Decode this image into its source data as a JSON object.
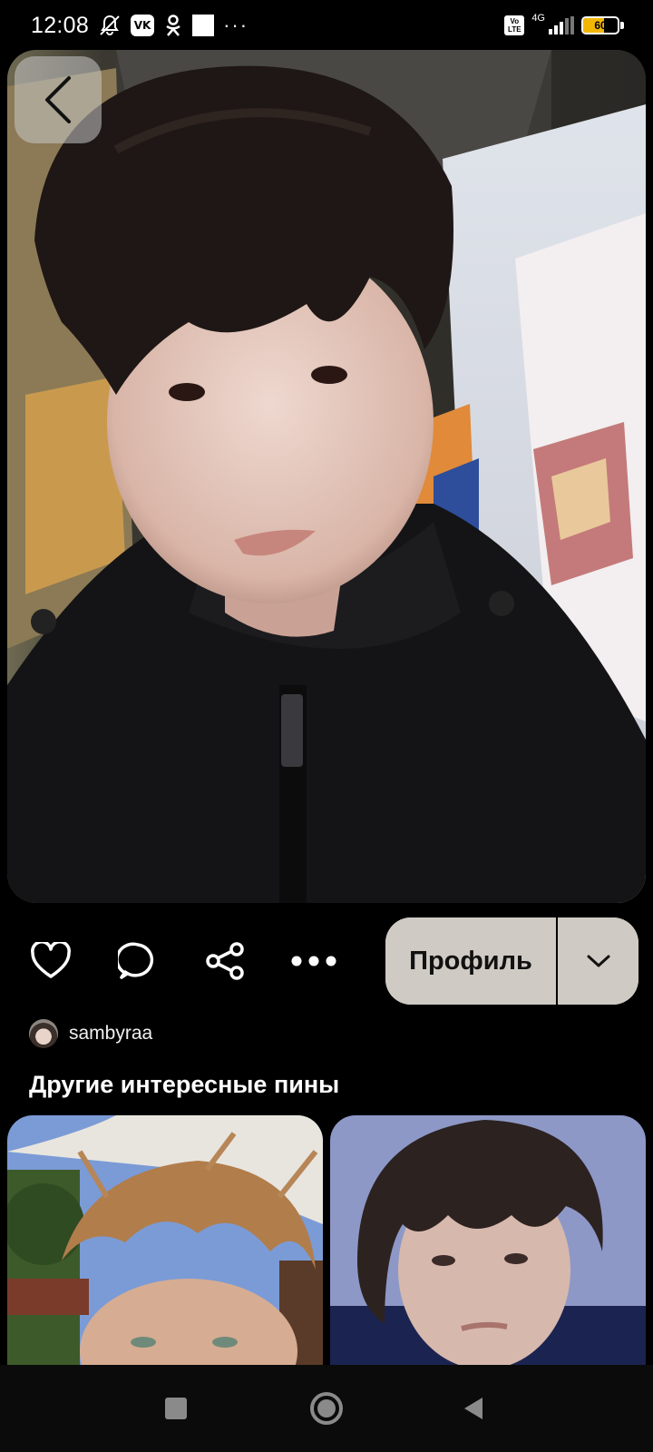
{
  "status_bar": {
    "time": "12:08",
    "icons": [
      "mute-bell-icon",
      "vk-icon",
      "odnoklassniki-icon",
      "square-icon",
      "more-dots-icon"
    ],
    "vk_label": "VK",
    "more_dots": "···",
    "volte_label": "Vo LTE",
    "network_label": "4G",
    "battery_level": "60"
  },
  "pin": {
    "image_icon": "photo-portrait",
    "back_icon": "chevron-left-icon"
  },
  "actions": {
    "like_icon": "heart-icon",
    "comment_icon": "comment-icon",
    "share_icon": "share-icon",
    "more_icon": "more-horizontal-icon",
    "profile_label": "Профиль",
    "dropdown_icon": "chevron-down-icon"
  },
  "author": {
    "name": "sambyraa"
  },
  "related": {
    "title": "Другие интересные пины",
    "cards": [
      {
        "icon": "photo-blond-guy"
      },
      {
        "icon": "photo-dark-hair-guy"
      }
    ]
  },
  "nav": {
    "recents_icon": "square-nav-icon",
    "home_icon": "circle-nav-icon",
    "back_icon": "triangle-back-icon"
  },
  "colors": {
    "background": "#000000",
    "profile_button": "#cfcac3",
    "battery": "#f2b705"
  }
}
